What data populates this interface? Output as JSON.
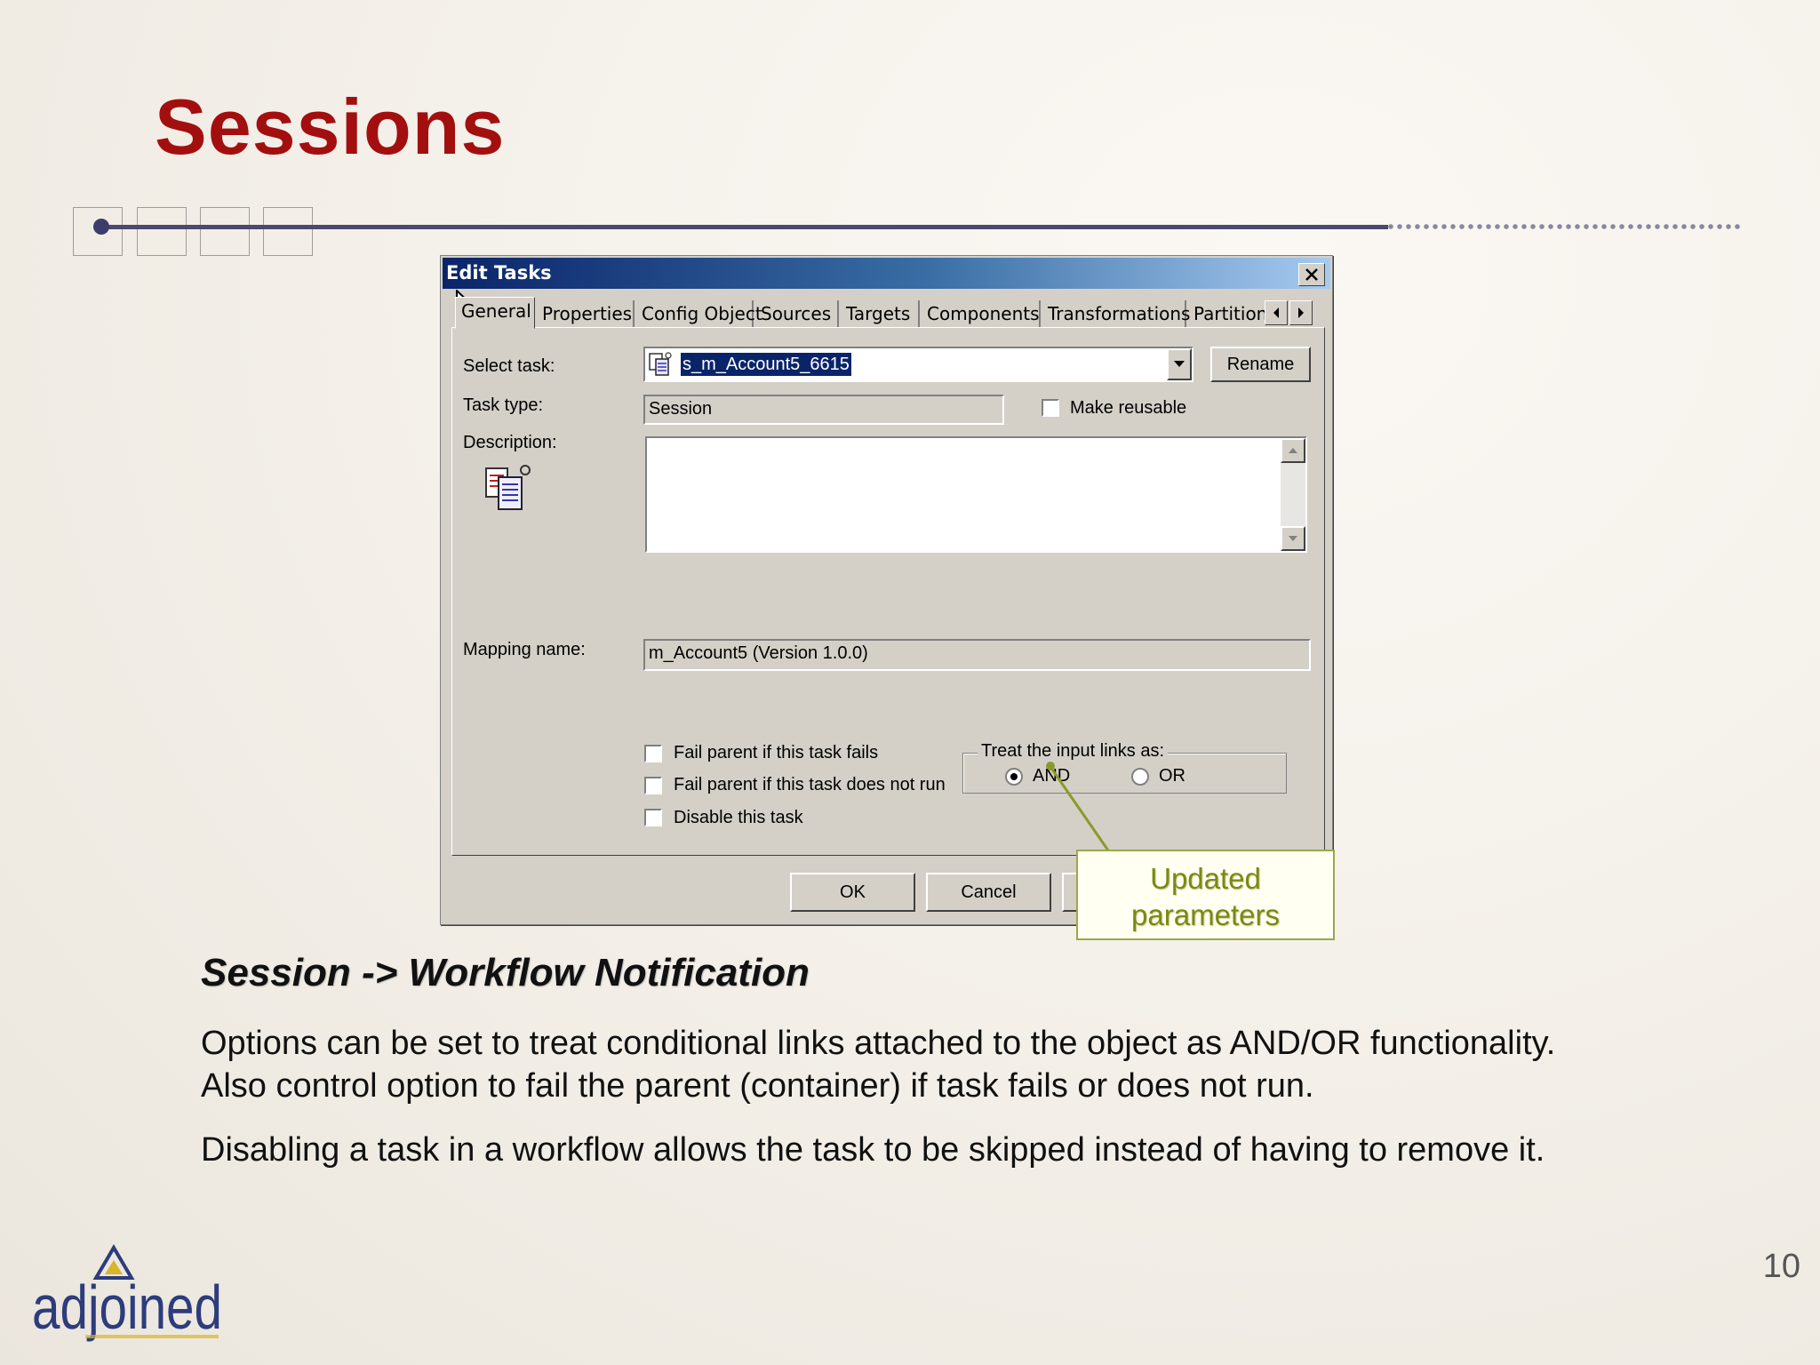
{
  "slide": {
    "title": "Sessions",
    "subheading": "Session -> Workflow Notification",
    "paragraph_1_line_1": "Options can be set to treat conditional links attached to the object as AND/OR functionality.",
    "paragraph_1_line_2": "Also control option to fail the parent (container) if task fails or does not run.",
    "paragraph_2": "Disabling a task in a workflow allows the task to be skipped instead of having to remove it.",
    "page_number": "10",
    "logo_text": "adjoined",
    "logo_colors": {
      "text": "#2c3c7c",
      "accent": "#d7b62a"
    }
  },
  "dialog": {
    "title": "Edit Tasks",
    "tabs": [
      "General",
      "Properties",
      "Config Object",
      "Sources",
      "Targets",
      "Components",
      "Transformations",
      "Partition"
    ],
    "active_tab": "General",
    "select_task_label": "Select task:",
    "select_task_value": "s_m_Account5_6615",
    "rename_button": "Rename",
    "task_type_label": "Task type:",
    "task_type_value": "Session",
    "make_reusable_label": "Make reusable",
    "make_reusable_checked": false,
    "description_label": "Description:",
    "description_value": "",
    "mapping_name_label": "Mapping name:",
    "mapping_name_value": "m_Account5 (Version 1.0.0)",
    "fail_parent_fails_label": "Fail parent if this task fails",
    "fail_parent_not_run_label": "Fail parent if this task does not run",
    "disable_task_label": "Disable this task",
    "input_links_group_label": "Treat the input links as:",
    "and_label": "AND",
    "or_label": "OR",
    "selected_link_mode": "AND",
    "ok_button": "OK",
    "cancel_button": "Cancel"
  },
  "callout": {
    "line_1": "Updated",
    "line_2": "parameters",
    "color": "#7a8a10"
  },
  "colors": {
    "title": "#a30f0f",
    "titlebar_start": "#0a246a",
    "titlebar_end": "#a6caf0",
    "dialog_face": "#d4d0c8"
  }
}
